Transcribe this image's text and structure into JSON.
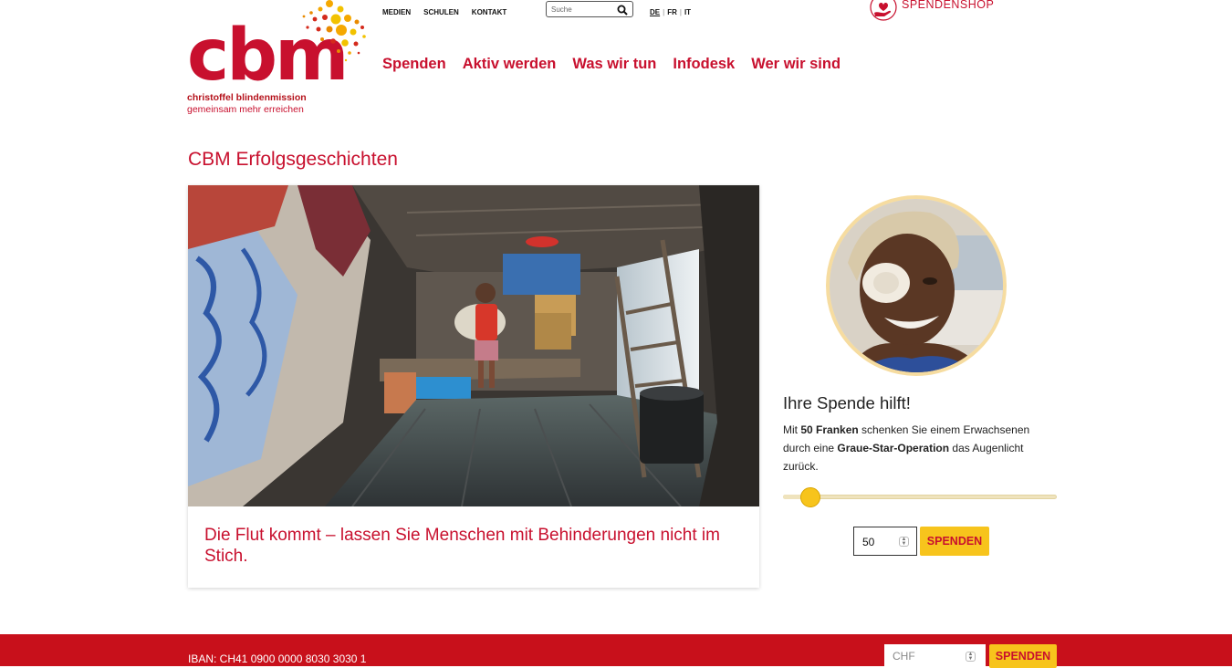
{
  "logo": {
    "wordmark": "cbm",
    "line1": "christoffel blindenmission",
    "line2": "gemeinsam mehr erreichen"
  },
  "topnav": [
    "MEDIEN",
    "SCHULEN",
    "KONTAKT"
  ],
  "search": {
    "placeholder": "Suche",
    "icon": "search-icon"
  },
  "languages": {
    "de": "DE",
    "fr": "FR",
    "it": "IT",
    "separator": "|",
    "active": "DE"
  },
  "shop": {
    "label": "SPENDENSHOP",
    "icon": "heart-hand-icon"
  },
  "mainnav": [
    "Spenden",
    "Aktiv werden",
    "Was wir tun",
    "Infodesk",
    "Wer wir sind"
  ],
  "page": {
    "title": "CBM Erfolgsgeschichten"
  },
  "story": {
    "title": "Die Flut kommt – lassen Sie Menschen mit Behinderungen nicht im Stich."
  },
  "donation": {
    "heading": "Ihre Spende hilft!",
    "text_pre": "Mit ",
    "amount_text": "50 Franken",
    "text_mid": " schenken Sie einem Erwachsenen durch eine ",
    "operation_text": "Graue-Star-Operation",
    "text_post": " das Augenlicht zurück.",
    "slider_fraction": 0.1,
    "amount_value": "50",
    "button_label": "SPENDEN"
  },
  "footer": {
    "iban": "IBAN: CH41 0900 0000 8030 3030 1",
    "chf_placeholder": "CHF",
    "button_label": "SPENDEN"
  },
  "colors": {
    "brand_red": "#c8102e",
    "footer_red": "#c8101b",
    "accent_yellow": "#f7c41c",
    "slider_track": "#efe3bd"
  }
}
